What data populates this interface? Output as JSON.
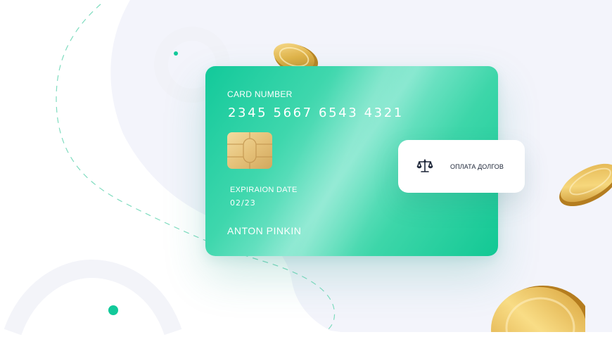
{
  "card": {
    "number_label": "CARD NUMBER",
    "number": "2345 5667 6543 4321",
    "expiry_label": "EXPIRAION DATE",
    "expiry_value": "02/23",
    "holder_name": "ANTON PINKIN",
    "chip_icon": "card-chip-icon"
  },
  "badge": {
    "icon": "scales-icon",
    "label": "ОПЛАТА ДОЛГОВ"
  },
  "colors": {
    "card_green": "#12c99a",
    "card_highlight": "#7ee6cc",
    "background_shape": "#f3f4fb",
    "accent_dot": "#12c99a",
    "dashed_path": "#7fdcbf",
    "coin_gold": "#e2b44a",
    "badge_text": "#1b2436"
  }
}
